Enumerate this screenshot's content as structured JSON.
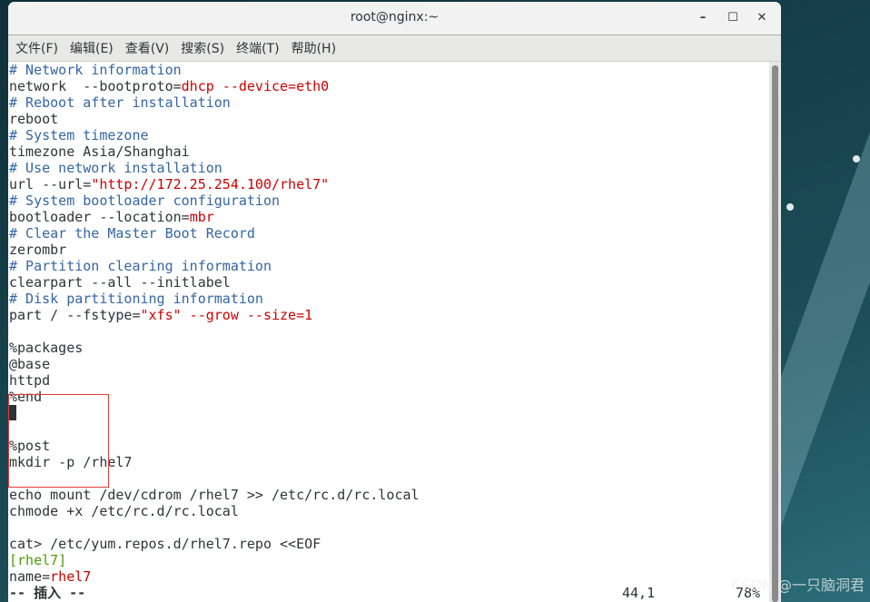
{
  "window": {
    "title": "root@nginx:~",
    "minimize": "–",
    "maximize": "☐",
    "close": "✕"
  },
  "menu": [
    "文件(F)",
    "编辑(E)",
    "查看(V)",
    "搜索(S)",
    "终端(T)",
    "帮助(H)"
  ],
  "lines": [
    [
      [
        "c-comment",
        "# Network information"
      ]
    ],
    [
      [
        "",
        "network  --bootproto="
      ],
      [
        "c-red",
        "dhcp --device=eth0"
      ]
    ],
    [
      [
        "c-comment",
        "# Reboot after installation"
      ]
    ],
    [
      [
        "",
        "reboot"
      ]
    ],
    [
      [
        "c-comment",
        "# System timezone"
      ]
    ],
    [
      [
        "",
        "timezone Asia/Shanghai"
      ]
    ],
    [
      [
        "c-comment",
        "# Use network installation"
      ]
    ],
    [
      [
        "",
        "url --url="
      ],
      [
        "c-red",
        "\"http://172.25.254.100/rhel7\""
      ]
    ],
    [
      [
        "c-comment",
        "# System bootloader configuration"
      ]
    ],
    [
      [
        "",
        "bootloader --location="
      ],
      [
        "c-red",
        "mbr"
      ]
    ],
    [
      [
        "c-comment",
        "# Clear the Master Boot Record"
      ]
    ],
    [
      [
        "",
        "zerombr"
      ]
    ],
    [
      [
        "c-comment",
        "# Partition clearing information"
      ]
    ],
    [
      [
        "",
        "clearpart --all --initlabel"
      ]
    ],
    [
      [
        "c-comment",
        "# Disk partitioning information"
      ]
    ],
    [
      [
        "",
        "part / --fstype="
      ],
      [
        "c-red",
        "\"xfs\" --grow --size=1"
      ]
    ],
    [],
    [
      [
        "",
        "%packages"
      ]
    ],
    [
      [
        "",
        "@base"
      ]
    ],
    [
      [
        "",
        "httpd"
      ]
    ],
    [
      [
        "",
        "%end"
      ]
    ],
    [
      [
        "cursor",
        ""
      ]
    ],
    [],
    [
      [
        "",
        "%post"
      ]
    ],
    [
      [
        "",
        "mkdir -p /rhel7"
      ]
    ],
    [],
    [
      [
        "",
        "echo mount /dev/cdrom /rhel7 >> /etc/rc.d/rc.local"
      ]
    ],
    [
      [
        "",
        "chmode +x /etc/rc.d/rc.local"
      ]
    ],
    [],
    [
      [
        "",
        "cat> /etc/yum.repos.d/rhel7.repo <<EOF"
      ]
    ],
    [
      [
        "c-green",
        "[rhel7]"
      ]
    ],
    [
      [
        "",
        "name="
      ],
      [
        "c-red",
        "rhel7"
      ]
    ]
  ],
  "status": {
    "mode": "-- 插入 --",
    "position": "44,1",
    "percent": "78%"
  },
  "watermark": "CSDN @一只脑洞君"
}
